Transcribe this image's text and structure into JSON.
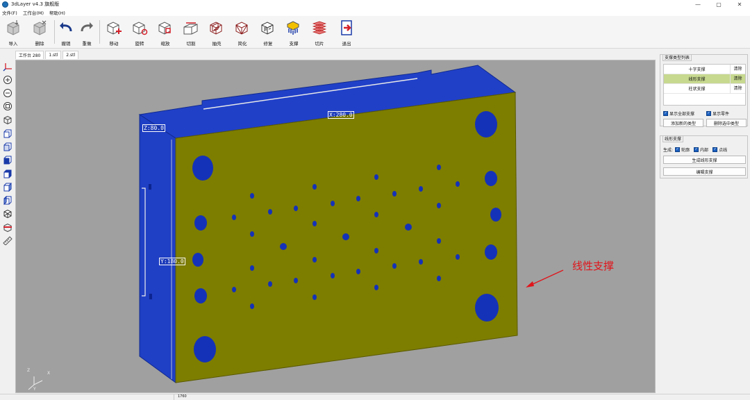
{
  "window": {
    "title": "3dLayer v4.3 旗舰版",
    "controls": [
      "—",
      "▢",
      "✕"
    ]
  },
  "menu": [
    "文件(F)",
    "工作台(M)",
    "帮助(H)"
  ],
  "toolbar": {
    "import": "导入",
    "delete": "删除",
    "undo": "撤销",
    "redo": "重做",
    "move": "移动",
    "rotate": "旋转",
    "scale": "缩放",
    "cut": "切割",
    "shell": "抽壳",
    "simplify": "简化",
    "repair": "修复",
    "support": "支撑",
    "slice": "切片",
    "exit": "退出"
  },
  "tabs": [
    "工作台 280",
    "1.stl",
    "2.stl"
  ],
  "viewport": {
    "dim_x": "X:280.0",
    "dim_y": "Y:180.0",
    "dim_z": "Z:80.0",
    "axis_z": "Z",
    "axis_x": "X",
    "axis_y": "Y"
  },
  "annotation": "线性支撑",
  "support_types": {
    "title": "支撑类型列表",
    "rows": [
      {
        "name": "十字支撑",
        "action": "清除"
      },
      {
        "name": "线形支撑",
        "action": "清除"
      },
      {
        "name": "柱状支撑",
        "action": "清除"
      }
    ],
    "show_all": "显示全部支撑",
    "show_parts": "显示零件",
    "add_type": "添加新的类型",
    "remove_type": "删除选中类型"
  },
  "line_support": {
    "title": "线形支撑",
    "generate_label": "生成:",
    "opt_outline": "轮廓",
    "opt_inner": "内部",
    "opt_dotline": "点线",
    "generate_btn": "生成线形支撑",
    "edit_btn": "编辑支撑"
  },
  "status": {
    "right": "1760"
  },
  "colors": {
    "model_face": "#7d7d00",
    "model_side": "#1f3fc4",
    "hole": "#1432b8",
    "viewport_bg": "#a0a0a0",
    "selected_row": "#c7d98f",
    "annotation": "#e0151b"
  }
}
